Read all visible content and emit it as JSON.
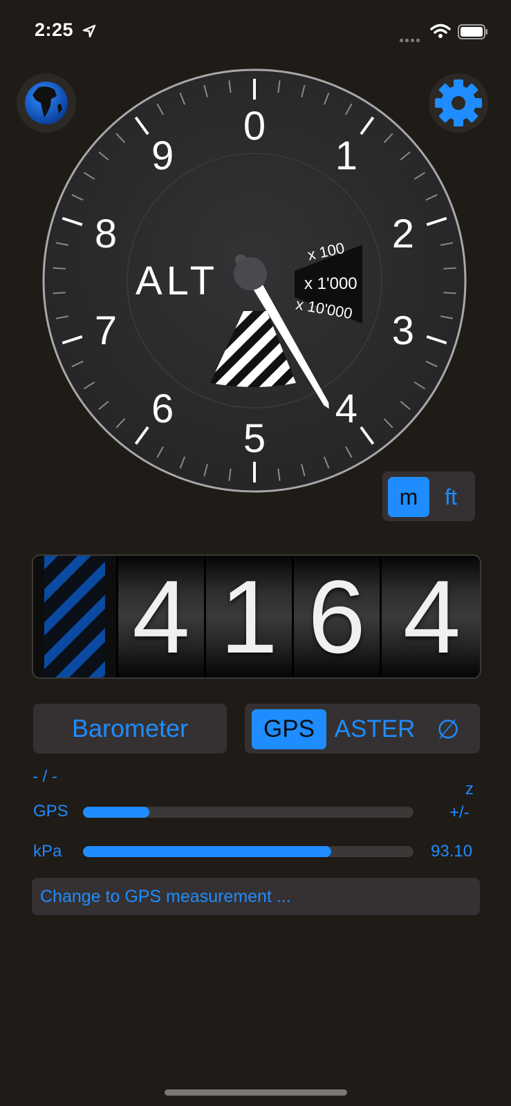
{
  "status_bar": {
    "time": "2:25",
    "location_icon": "location-arrow-icon",
    "signal_icon": "cellular-signal-icon",
    "wifi_icon": "wifi-icon",
    "battery_icon": "battery-icon"
  },
  "header": {
    "globe_icon": "globe-icon",
    "settings_icon": "gear-icon"
  },
  "gauge": {
    "label": "ALT",
    "dial_numbers": [
      "0",
      "1",
      "2",
      "3",
      "4",
      "5",
      "6",
      "7",
      "8",
      "9"
    ],
    "multipliers": [
      "x 100",
      "x 1'000",
      "x 10'000"
    ],
    "needle_value": 4.16,
    "colors": {
      "face": "#2b2a2c",
      "needle": "#ffffff",
      "rim": "#9e9e9e"
    }
  },
  "unit_toggle": {
    "options": [
      "m",
      "ft"
    ],
    "selected": "m"
  },
  "altitude": {
    "digits": [
      "4",
      "1",
      "6",
      "4"
    ],
    "value": 4164
  },
  "source": {
    "barometer_label": "Barometer",
    "options": [
      "GPS",
      "ASTER",
      "∅"
    ],
    "selected": "GPS"
  },
  "readouts": {
    "dash_label": "- / -",
    "z_label": "z",
    "gps_label": "GPS",
    "gps_pm_label": "+/-",
    "gps_progress": 0.2,
    "kpa_label": "kPa",
    "kpa_value": "93.10",
    "kpa_progress": 0.75
  },
  "message": "Change to GPS measurement ...",
  "colors": {
    "background": "#1f1b17",
    "accent": "#1f8cff",
    "control_bg": "#353132"
  }
}
